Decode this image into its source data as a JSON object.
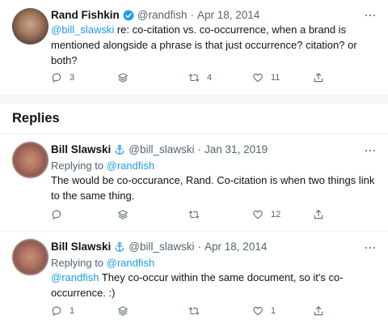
{
  "main_tweet": {
    "author_name": "Rand Fishkin",
    "handle": "@randfish",
    "date": "Apr 18, 2014",
    "mention": "@bill_slawski",
    "text": " re: co-citation vs. co-occurrence, when a brand is mentioned alongside a phrase is that just occurrence? citation? or both?",
    "stats": {
      "replies": "3",
      "retweets": "4",
      "likes": "11"
    }
  },
  "replies_section": {
    "heading": "Replies"
  },
  "replies": [
    {
      "author_name": "Bill Slawski",
      "handle": "@bill_slawski",
      "date": "Jan 31, 2019",
      "replying_to_prefix": "Replying to ",
      "replying_to": "@randfish",
      "text": "The would be co-occurance, Rand. Co-citation is when two things link to the same thing.",
      "stats": {
        "replies": "",
        "retweets": "",
        "likes": "12"
      }
    },
    {
      "author_name": "Bill Slawski",
      "handle": "@bill_slawski",
      "date": "Apr 18, 2014",
      "replying_to_prefix": "Replying to ",
      "replying_to": "@randfish",
      "mention": "@randfish",
      "text": " They co-occur within the same document, so it's co-occurrence. :)",
      "stats": {
        "replies": "1",
        "retweets": "",
        "likes": "1"
      }
    }
  ],
  "colors": {
    "accent": "#1d9bf0",
    "muted": "#536471",
    "text": "#0f1419"
  },
  "icons": [
    "verified-badge-icon",
    "anchor-icon",
    "more-icon",
    "reply-icon",
    "stack-icon",
    "retweet-icon",
    "like-icon",
    "share-icon"
  ]
}
